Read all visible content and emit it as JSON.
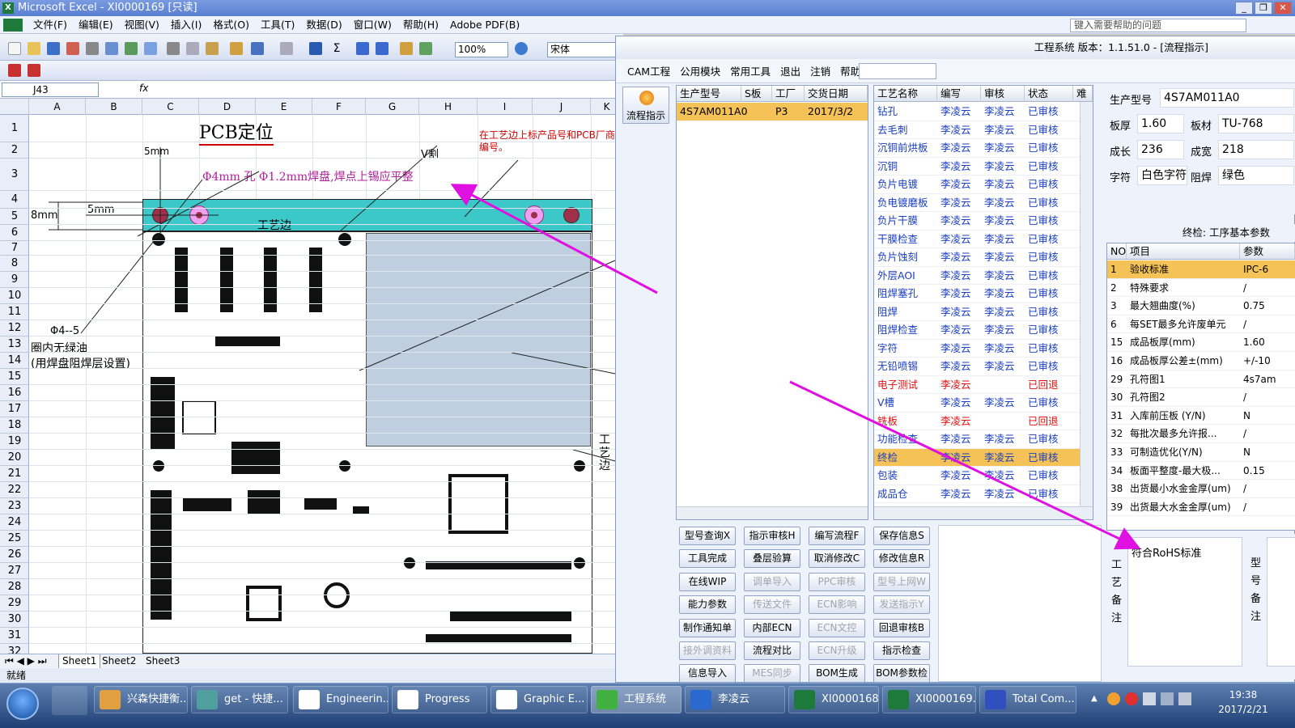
{
  "excel": {
    "title": "Microsoft Excel - XI0000169  [只读]",
    "menu": [
      "文件(F)",
      "编辑(E)",
      "视图(V)",
      "插入(I)",
      "格式(O)",
      "工具(T)",
      "数据(D)",
      "窗口(W)",
      "帮助(H)",
      "Adobe PDF(B)"
    ],
    "help_placeholder": "键入需要帮助的问题",
    "zoom": "100%",
    "font": "宋体",
    "namebox": "J43",
    "fx": "fx",
    "columns": [
      "A",
      "B",
      "C",
      "D",
      "E",
      "F",
      "G",
      "H",
      "I",
      "J",
      "K"
    ],
    "rows": [
      "1",
      "2",
      "3",
      "4",
      "5",
      "6",
      "7",
      "8",
      "9",
      "10",
      "11",
      "12",
      "13",
      "14",
      "15",
      "16",
      "17",
      "18",
      "19",
      "20",
      "21",
      "22",
      "23",
      "24",
      "25",
      "26",
      "27",
      "28",
      "29",
      "30",
      "31",
      "32"
    ],
    "sheets": [
      "Sheet1",
      "Sheet2",
      "Sheet3"
    ],
    "status": "就绪",
    "drawing": {
      "title": "PCB定位",
      "note": "在工艺边上标产品号和PCB厂商编号。",
      "d5mm_top": "5mm",
      "vcut": "V割",
      "hole_note": "Φ4mm 孔 Φ1.2mm焊盘,焊点上锡应平整",
      "d8mm": "8mm",
      "d5mm_left": "5mm",
      "edge": "工艺边",
      "phi": "Φ4--5",
      "circle_note1": "圈内无绿油",
      "circle_note2": "(用焊盘阻焊层设置)",
      "edge_v": "工艺边"
    }
  },
  "cam": {
    "title": "工程系统    版本：1.1.51.0 - [流程指示]",
    "menu": [
      "CAM工程",
      "公用模块",
      "常用工具",
      "退出",
      "注销",
      "帮助"
    ],
    "flow_button": "流程指示",
    "order_headers": [
      "生产型号",
      "S板",
      "工厂",
      "交货日期"
    ],
    "order_row": [
      "4S7AM011A0",
      "",
      "P3",
      "2017/3/2"
    ],
    "process_headers": [
      "工艺名称",
      "编写",
      "审核",
      "状态",
      "难"
    ],
    "processes": [
      {
        "name": "钻孔",
        "w": "李凌云",
        "r": "李凌云",
        "s": "已审核"
      },
      {
        "name": "去毛刺",
        "w": "李凌云",
        "r": "李凌云",
        "s": "已审核"
      },
      {
        "name": "沉铜前烘板",
        "w": "李凌云",
        "r": "李凌云",
        "s": "已审核"
      },
      {
        "name": "沉铜",
        "w": "李凌云",
        "r": "李凌云",
        "s": "已审核"
      },
      {
        "name": "负片电镀",
        "w": "李凌云",
        "r": "李凌云",
        "s": "已审核"
      },
      {
        "name": "负电镀磨板",
        "w": "李凌云",
        "r": "李凌云",
        "s": "已审核"
      },
      {
        "name": "负片干膜",
        "w": "李凌云",
        "r": "李凌云",
        "s": "已审核"
      },
      {
        "name": "干膜检查",
        "w": "李凌云",
        "r": "李凌云",
        "s": "已审核"
      },
      {
        "name": "负片蚀刻",
        "w": "李凌云",
        "r": "李凌云",
        "s": "已审核"
      },
      {
        "name": "外层AOI",
        "w": "李凌云",
        "r": "李凌云",
        "s": "已审核"
      },
      {
        "name": "阻焊塞孔",
        "w": "李凌云",
        "r": "李凌云",
        "s": "已审核"
      },
      {
        "name": "阻焊",
        "w": "李凌云",
        "r": "李凌云",
        "s": "已审核"
      },
      {
        "name": "阻焊检查",
        "w": "李凌云",
        "r": "李凌云",
        "s": "已审核"
      },
      {
        "name": "字符",
        "w": "李凌云",
        "r": "李凌云",
        "s": "已审核"
      },
      {
        "name": "无铅喷锡",
        "w": "李凌云",
        "r": "李凌云",
        "s": "已审核"
      },
      {
        "name": "电子测试",
        "w": "李凌云",
        "r": "",
        "s": "已回退"
      },
      {
        "name": "V槽",
        "w": "李凌云",
        "r": "李凌云",
        "s": "已审核"
      },
      {
        "name": "铣板",
        "w": "李凌云",
        "r": "",
        "s": "已回退"
      },
      {
        "name": "功能检查",
        "w": "李凌云",
        "r": "李凌云",
        "s": "已审核"
      },
      {
        "name": "终检",
        "w": "李凌云",
        "r": "李凌云",
        "s": "已审核"
      },
      {
        "name": "包装",
        "w": "李凌云",
        "r": "李凌云",
        "s": "已审核"
      },
      {
        "name": "成品仓",
        "w": "李凌云",
        "r": "李凌云",
        "s": "已审核"
      }
    ],
    "buttons": [
      [
        "型号查询X",
        "指示审核H",
        "编写流程F",
        "保存信息S"
      ],
      [
        "工具完成",
        "叠层验算",
        "取消修改C",
        "修改信息R"
      ],
      [
        "在线WIP",
        "调单导入",
        "PPC审核",
        "型号上网W"
      ],
      [
        "能力参数",
        "传送文件",
        "ECN影响",
        "发送指示Y"
      ],
      [
        "制作通知单",
        "内部ECN",
        "ECN文控",
        "回退审核B"
      ],
      [
        "接外调资料",
        "流程对比",
        "ECN升级",
        "指示检查"
      ],
      [
        "信息导入",
        "MES同步",
        "BOM生成",
        "BOM参数检查"
      ]
    ],
    "disabled": [
      "调单导入",
      "PPC审核",
      "型号上网W",
      "传送文件",
      "ECN影响",
      "发送指示Y",
      "ECN文控",
      "接外调资料",
      "ECN升级",
      "MES同步"
    ],
    "info": {
      "model_label": "生产型号",
      "model": "4S7AM011A0",
      "thick_label": "板厚",
      "thick": "1.60",
      "mat_label": "板材",
      "mat": "TU-768",
      "len_label": "成长",
      "len": "236",
      "wid_label": "成宽",
      "wid": "218",
      "char_label": "字符",
      "char": "白色字符",
      "mask_label": "阻焊",
      "mask": "绿色"
    },
    "params_title": "终检: 工序基本参数",
    "param_headers": [
      "NO",
      "项目",
      "参数"
    ],
    "params": [
      [
        "1",
        "验收标准",
        "IPC-6"
      ],
      [
        "2",
        "特殊要求",
        "/"
      ],
      [
        "3",
        "最大翘曲度(%)",
        "0.75"
      ],
      [
        "6",
        "每SET最多允许废单元",
        "/"
      ],
      [
        "15",
        "成品板厚(mm)",
        "1.60"
      ],
      [
        "16",
        "成品板厚公差±(mm)",
        "+/-10"
      ],
      [
        "29",
        "孔符图1",
        "4s7am"
      ],
      [
        "30",
        "孔符图2",
        "/"
      ],
      [
        "31",
        "入库前压板 (Y/N)",
        "N"
      ],
      [
        "32",
        "每批次最多允许报...",
        "/"
      ],
      [
        "33",
        "可制造优化(Y/N)",
        "N"
      ],
      [
        "34",
        "板面平整度-最大极...",
        "0.15"
      ],
      [
        "38",
        "出货最小水金金厚(um)",
        "/"
      ],
      [
        "39",
        "出货最大水金金厚(um)",
        "/"
      ]
    ],
    "remark_label": "工艺备注",
    "remark": "符合RoHS标准",
    "type_remark_label": "型号备注"
  },
  "taskbar": {
    "tasks": [
      "兴森快捷衡...",
      "get - 快捷...",
      "Engineerin...",
      "Progress",
      "Graphic E...",
      "工程系统",
      "李凌云",
      "XI0000168...",
      "XI0000169...",
      "Total Com..."
    ],
    "time": "19:38",
    "date": "2017/2/21"
  },
  "colors": {
    "accent": "#f4c256",
    "magenta": "#e010e0",
    "board_edge": "#3cc8c8"
  }
}
